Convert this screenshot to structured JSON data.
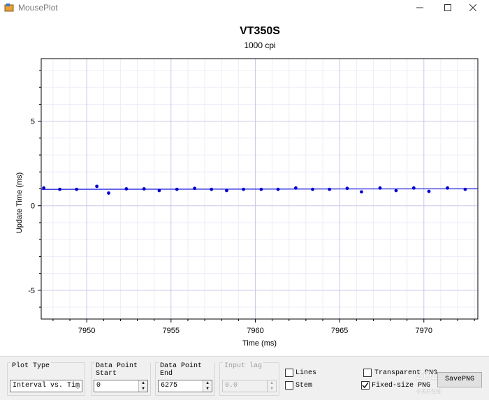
{
  "window": {
    "title": "MousePlot"
  },
  "plot": {
    "title": "VT350S",
    "subtitle": "1000 cpi"
  },
  "chart_data": {
    "type": "scatter",
    "title": "VT350S",
    "subtitle": "1000 cpi",
    "xlabel": "Time (ms)",
    "ylabel": "Update Time (ms)",
    "xlim": [
      7947.3,
      7973.2
    ],
    "ylim": [
      -6.7,
      8.7
    ],
    "xticks": [
      7950,
      7955,
      7960,
      7965,
      7970
    ],
    "yticks": [
      -5,
      0,
      5
    ],
    "grid": true,
    "line_color": "#2020e0",
    "point_color": "#0000cc",
    "trend_line": {
      "x": [
        7947.3,
        7973.2
      ],
      "y": [
        0.97,
        1.0
      ]
    },
    "points": [
      {
        "x": 7947.45,
        "y": 1.05
      },
      {
        "x": 7948.4,
        "y": 0.97
      },
      {
        "x": 7949.4,
        "y": 0.97
      },
      {
        "x": 7950.6,
        "y": 1.15
      },
      {
        "x": 7951.3,
        "y": 0.75
      },
      {
        "x": 7952.35,
        "y": 1.0
      },
      {
        "x": 7953.4,
        "y": 1.0
      },
      {
        "x": 7954.3,
        "y": 0.9
      },
      {
        "x": 7955.35,
        "y": 0.97
      },
      {
        "x": 7956.4,
        "y": 1.03
      },
      {
        "x": 7957.4,
        "y": 0.97
      },
      {
        "x": 7958.3,
        "y": 0.9
      },
      {
        "x": 7959.3,
        "y": 0.97
      },
      {
        "x": 7960.35,
        "y": 0.97
      },
      {
        "x": 7961.35,
        "y": 0.97
      },
      {
        "x": 7962.4,
        "y": 1.05
      },
      {
        "x": 7963.4,
        "y": 0.97
      },
      {
        "x": 7964.4,
        "y": 0.97
      },
      {
        "x": 7965.45,
        "y": 1.03
      },
      {
        "x": 7966.3,
        "y": 0.82
      },
      {
        "x": 7967.4,
        "y": 1.05
      },
      {
        "x": 7968.35,
        "y": 0.9
      },
      {
        "x": 7969.4,
        "y": 1.05
      },
      {
        "x": 7970.3,
        "y": 0.85
      },
      {
        "x": 7971.4,
        "y": 1.05
      },
      {
        "x": 7972.45,
        "y": 0.97
      }
    ]
  },
  "controls": {
    "plot_type": {
      "label": "Plot Type",
      "value": "Interval vs. Tim"
    },
    "data_point_start": {
      "label": "Data Point Start",
      "value": "0"
    },
    "data_point_end": {
      "label": "Data Point End",
      "value": "6275"
    },
    "input_lag": {
      "label": "Input lag",
      "value": "0.0"
    },
    "lines": {
      "label": "Lines",
      "checked": false
    },
    "stem": {
      "label": "Stem",
      "checked": false
    },
    "transparent_png": {
      "label": "Transparent PNG",
      "checked": false
    },
    "fixed_size_png": {
      "label": "Fixed-size PNG",
      "checked": true
    },
    "save_png": {
      "label": "SavePNG"
    }
  },
  "watermark": {
    "text": "ZOL",
    "sub": "中关村在线"
  }
}
